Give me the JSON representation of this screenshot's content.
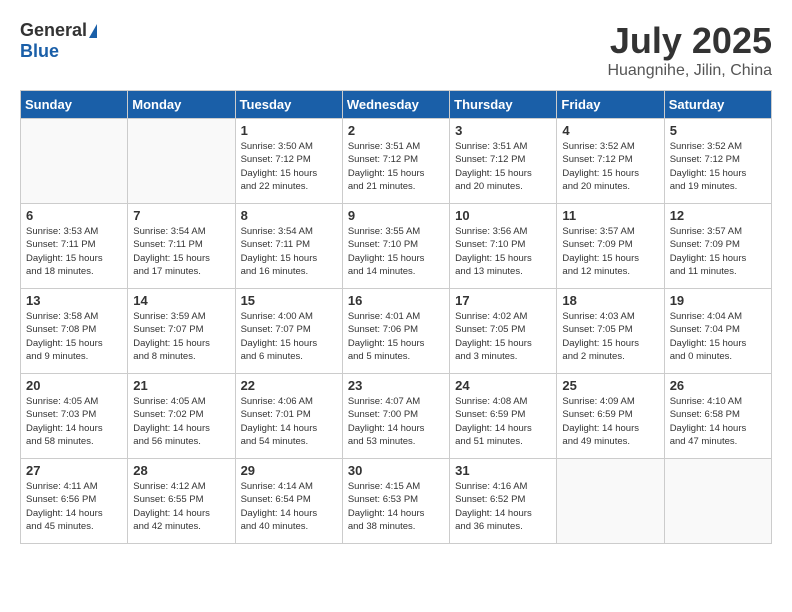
{
  "header": {
    "logo_general": "General",
    "logo_blue": "Blue",
    "title": "July 2025",
    "location": "Huangnihe, Jilin, China"
  },
  "days_of_week": [
    "Sunday",
    "Monday",
    "Tuesday",
    "Wednesday",
    "Thursday",
    "Friday",
    "Saturday"
  ],
  "weeks": [
    [
      {
        "num": "",
        "info": ""
      },
      {
        "num": "",
        "info": ""
      },
      {
        "num": "1",
        "info": "Sunrise: 3:50 AM\nSunset: 7:12 PM\nDaylight: 15 hours\nand 22 minutes."
      },
      {
        "num": "2",
        "info": "Sunrise: 3:51 AM\nSunset: 7:12 PM\nDaylight: 15 hours\nand 21 minutes."
      },
      {
        "num": "3",
        "info": "Sunrise: 3:51 AM\nSunset: 7:12 PM\nDaylight: 15 hours\nand 20 minutes."
      },
      {
        "num": "4",
        "info": "Sunrise: 3:52 AM\nSunset: 7:12 PM\nDaylight: 15 hours\nand 20 minutes."
      },
      {
        "num": "5",
        "info": "Sunrise: 3:52 AM\nSunset: 7:12 PM\nDaylight: 15 hours\nand 19 minutes."
      }
    ],
    [
      {
        "num": "6",
        "info": "Sunrise: 3:53 AM\nSunset: 7:11 PM\nDaylight: 15 hours\nand 18 minutes."
      },
      {
        "num": "7",
        "info": "Sunrise: 3:54 AM\nSunset: 7:11 PM\nDaylight: 15 hours\nand 17 minutes."
      },
      {
        "num": "8",
        "info": "Sunrise: 3:54 AM\nSunset: 7:11 PM\nDaylight: 15 hours\nand 16 minutes."
      },
      {
        "num": "9",
        "info": "Sunrise: 3:55 AM\nSunset: 7:10 PM\nDaylight: 15 hours\nand 14 minutes."
      },
      {
        "num": "10",
        "info": "Sunrise: 3:56 AM\nSunset: 7:10 PM\nDaylight: 15 hours\nand 13 minutes."
      },
      {
        "num": "11",
        "info": "Sunrise: 3:57 AM\nSunset: 7:09 PM\nDaylight: 15 hours\nand 12 minutes."
      },
      {
        "num": "12",
        "info": "Sunrise: 3:57 AM\nSunset: 7:09 PM\nDaylight: 15 hours\nand 11 minutes."
      }
    ],
    [
      {
        "num": "13",
        "info": "Sunrise: 3:58 AM\nSunset: 7:08 PM\nDaylight: 15 hours\nand 9 minutes."
      },
      {
        "num": "14",
        "info": "Sunrise: 3:59 AM\nSunset: 7:07 PM\nDaylight: 15 hours\nand 8 minutes."
      },
      {
        "num": "15",
        "info": "Sunrise: 4:00 AM\nSunset: 7:07 PM\nDaylight: 15 hours\nand 6 minutes."
      },
      {
        "num": "16",
        "info": "Sunrise: 4:01 AM\nSunset: 7:06 PM\nDaylight: 15 hours\nand 5 minutes."
      },
      {
        "num": "17",
        "info": "Sunrise: 4:02 AM\nSunset: 7:05 PM\nDaylight: 15 hours\nand 3 minutes."
      },
      {
        "num": "18",
        "info": "Sunrise: 4:03 AM\nSunset: 7:05 PM\nDaylight: 15 hours\nand 2 minutes."
      },
      {
        "num": "19",
        "info": "Sunrise: 4:04 AM\nSunset: 7:04 PM\nDaylight: 15 hours\nand 0 minutes."
      }
    ],
    [
      {
        "num": "20",
        "info": "Sunrise: 4:05 AM\nSunset: 7:03 PM\nDaylight: 14 hours\nand 58 minutes."
      },
      {
        "num": "21",
        "info": "Sunrise: 4:05 AM\nSunset: 7:02 PM\nDaylight: 14 hours\nand 56 minutes."
      },
      {
        "num": "22",
        "info": "Sunrise: 4:06 AM\nSunset: 7:01 PM\nDaylight: 14 hours\nand 54 minutes."
      },
      {
        "num": "23",
        "info": "Sunrise: 4:07 AM\nSunset: 7:00 PM\nDaylight: 14 hours\nand 53 minutes."
      },
      {
        "num": "24",
        "info": "Sunrise: 4:08 AM\nSunset: 6:59 PM\nDaylight: 14 hours\nand 51 minutes."
      },
      {
        "num": "25",
        "info": "Sunrise: 4:09 AM\nSunset: 6:59 PM\nDaylight: 14 hours\nand 49 minutes."
      },
      {
        "num": "26",
        "info": "Sunrise: 4:10 AM\nSunset: 6:58 PM\nDaylight: 14 hours\nand 47 minutes."
      }
    ],
    [
      {
        "num": "27",
        "info": "Sunrise: 4:11 AM\nSunset: 6:56 PM\nDaylight: 14 hours\nand 45 minutes."
      },
      {
        "num": "28",
        "info": "Sunrise: 4:12 AM\nSunset: 6:55 PM\nDaylight: 14 hours\nand 42 minutes."
      },
      {
        "num": "29",
        "info": "Sunrise: 4:14 AM\nSunset: 6:54 PM\nDaylight: 14 hours\nand 40 minutes."
      },
      {
        "num": "30",
        "info": "Sunrise: 4:15 AM\nSunset: 6:53 PM\nDaylight: 14 hours\nand 38 minutes."
      },
      {
        "num": "31",
        "info": "Sunrise: 4:16 AM\nSunset: 6:52 PM\nDaylight: 14 hours\nand 36 minutes."
      },
      {
        "num": "",
        "info": ""
      },
      {
        "num": "",
        "info": ""
      }
    ]
  ]
}
